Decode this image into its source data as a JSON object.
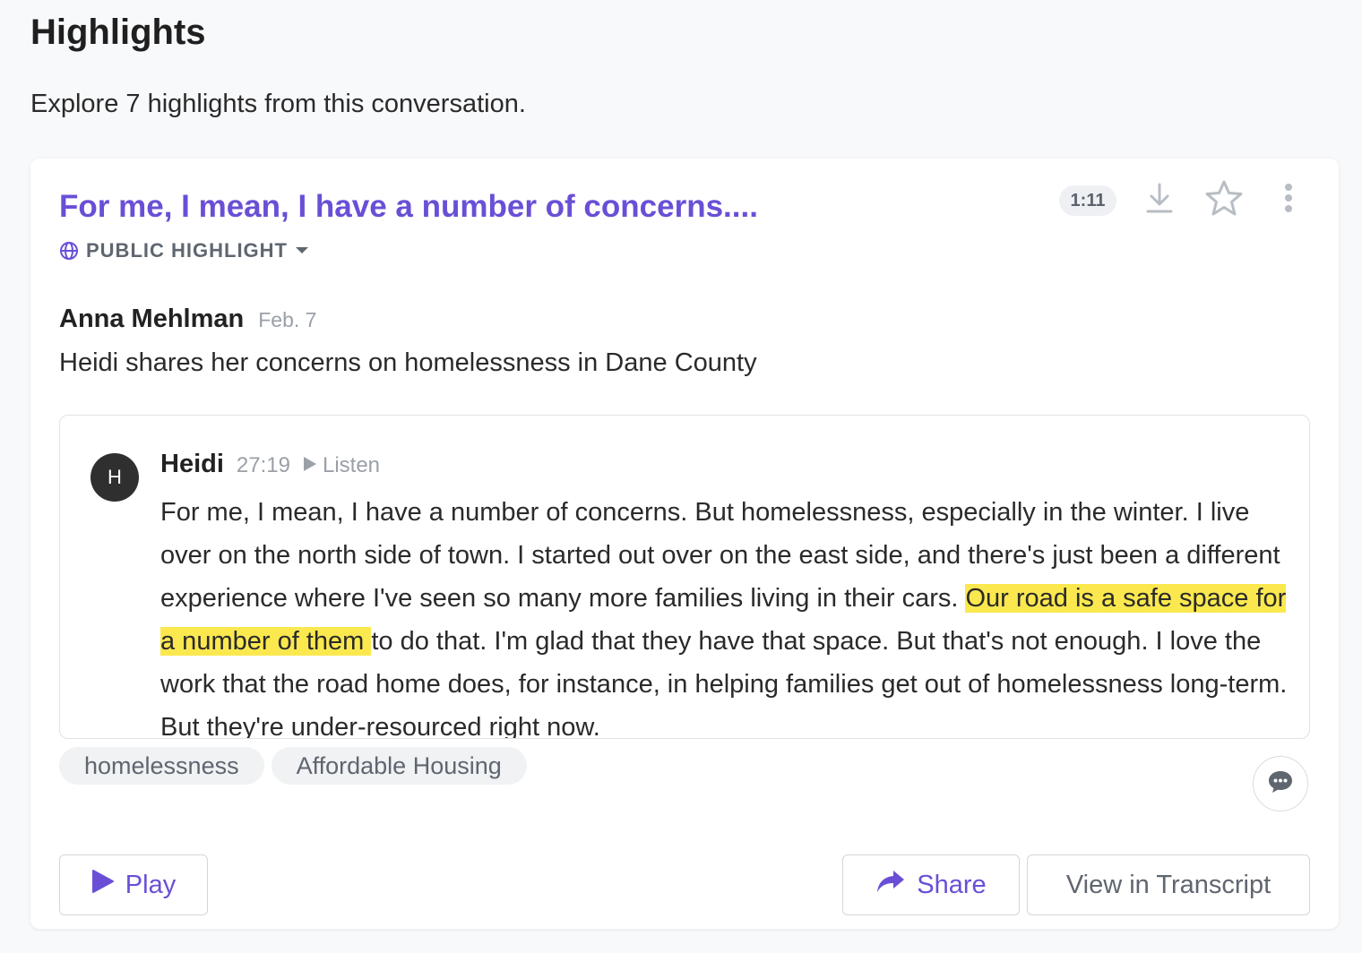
{
  "page": {
    "title": "Highlights",
    "subtitle": "Explore 7 highlights from this conversation."
  },
  "highlight": {
    "title": "For me, I mean, I have a number of concerns....",
    "visibility_label": "PUBLIC HIGHLIGHT",
    "duration": "1:11",
    "author": "Anna Mehlman",
    "date": "Feb. 7",
    "description": "Heidi shares her concerns on homelessness in Dane County",
    "quote": {
      "avatar_initial": "H",
      "speaker": "Heidi",
      "timestamp": "27:19",
      "listen_label": "Listen",
      "text_before": "For me, I mean, I have a number of concerns. But homelessness, especially in the winter. I live over on the north side of town. I started out over on the east side, and there's just been a different experience where I've seen so many more families living in their cars. ",
      "text_highlighted": "Our road is a safe space for a number of them ",
      "text_after": "to do that. I'm glad that they have that space. But that's not enough. I love the work that the road home does, for instance, in helping families get out of homelessness long-term. But they're under-resourced right now."
    },
    "tags": [
      "homelessness",
      "Affordable Housing"
    ],
    "actions": {
      "play_label": "Play",
      "share_label": "Share",
      "transcript_label": "View in Transcript"
    }
  },
  "colors": {
    "accent": "#6a4fd6",
    "highlight": "#fbe84f",
    "muted": "#5f6670"
  },
  "icons": [
    "globe-icon",
    "caret-down-icon",
    "download-icon",
    "star-icon",
    "more-vertical-icon",
    "play-small-icon",
    "comment-icon",
    "play-icon",
    "share-arrow-icon"
  ]
}
